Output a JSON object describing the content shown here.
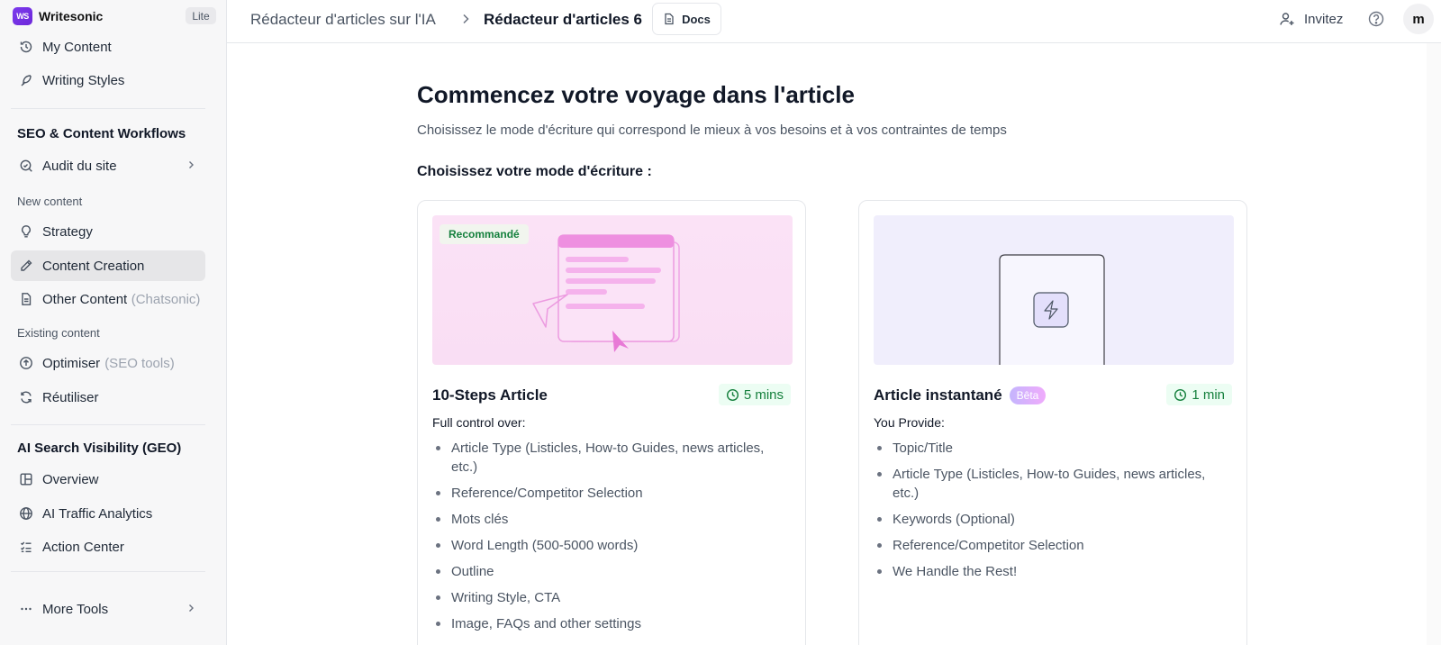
{
  "brand": {
    "name": "Writesonic",
    "logo_text": "WS",
    "plan": "Lite"
  },
  "sidebar": {
    "top_items": [
      {
        "label": "My Content",
        "icon": "history-icon"
      },
      {
        "label": "Writing Styles",
        "icon": "feather-icon"
      }
    ],
    "seo_section": {
      "title": "SEO & Content Workflows",
      "audit_label": "Audit du site"
    },
    "new_content": {
      "title": "New content",
      "items": [
        {
          "label": "Strategy",
          "icon": "lightbulb-icon"
        },
        {
          "label": "Content Creation",
          "icon": "pencil-icon",
          "active": true
        },
        {
          "label": "Other Content",
          "muted": "(Chatsonic)",
          "icon": "document-icon"
        }
      ]
    },
    "existing_content": {
      "title": "Existing content",
      "items": [
        {
          "label": "Optimiser",
          "muted": "(SEO tools)",
          "icon": "arrow-up-circle-icon"
        },
        {
          "label": "Réutiliser",
          "icon": "refresh-icon"
        }
      ]
    },
    "geo_section": {
      "title": "AI Search Visibility (GEO)",
      "items": [
        {
          "label": "Overview",
          "icon": "layout-icon"
        },
        {
          "label": "AI Traffic Analytics",
          "icon": "globe-icon"
        },
        {
          "label": "Action Center",
          "icon": "checklist-icon"
        }
      ]
    },
    "more_tools": "More Tools"
  },
  "header": {
    "breadcrumb_parent": "Rédacteur d'articles sur l'IA",
    "breadcrumb_current": "Rédacteur d'articles 6",
    "docs_label": "Docs",
    "invite_label": "Invitez",
    "avatar_initial": "m"
  },
  "main": {
    "title": "Commencez votre voyage dans l'article",
    "description": "Choisissez le mode d'écriture qui correspond le mieux à vos besoins et à vos contraintes de temps",
    "mode_label": "Choisissez votre mode d'écriture :",
    "cards": [
      {
        "badge": "Recommandé",
        "title": "10-Steps Article",
        "time": "5 mins",
        "subtitle": "Full control over:",
        "features": [
          "Article Type (Listicles, How-to Guides, news articles, etc.)",
          "Reference/Competitor Selection",
          "Mots clés",
          "Word Length (500-5000 words)",
          "Outline",
          "Writing Style, CTA",
          "Image, FAQs and other settings"
        ]
      },
      {
        "title": "Article instantané",
        "beta": "Bêta",
        "time": "1 min",
        "subtitle": "You Provide:",
        "features": [
          "Topic/Title",
          "Article Type (Listicles, How-to Guides, news articles, etc.)",
          "Keywords (Optional)",
          "Reference/Competitor Selection",
          "We Handle the Rest!"
        ]
      }
    ]
  },
  "colors": {
    "accent": "#7c3aed",
    "success": "#15803d",
    "active_bg": "#e6e6e8"
  }
}
